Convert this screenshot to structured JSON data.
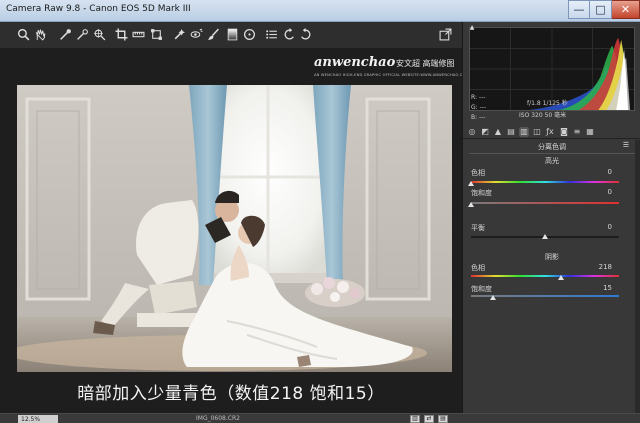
{
  "window": {
    "title": "Camera Raw 9.8 - Canon EOS 5D Mark III",
    "minimize_glyph": "—",
    "maximize_glyph": "□",
    "close_glyph": "✕"
  },
  "toolbar": {
    "tools": [
      "zoom-icon",
      "hand-icon",
      "white-balance-icon",
      "color-sampler-icon",
      "targeted-adjustment-icon",
      "crop-icon",
      "straighten-icon",
      "transform-icon",
      "spot-removal-icon",
      "red-eye-icon",
      "adjustment-brush-icon",
      "graduated-filter-icon",
      "radial-filter-icon",
      "preferences-icon",
      "rotate-left-icon",
      "rotate-right-icon"
    ],
    "fullscreen_icon": "fullscreen-icon"
  },
  "watermark": {
    "script": "anwenchao",
    "cn": "安文超 高端修图",
    "sub": "AN WENCHAO HIGH-END GRAPHIC OFFICIAL WEBSITE:WWW.ANWENCHAO.COM"
  },
  "caption": "暗部加入少量青色（数值218 饱和15）",
  "status": {
    "zoom": "12.5%",
    "filename": "IMG_0608.CR2"
  },
  "readout": {
    "r": "R:  ---",
    "g": "G:  ---",
    "b": "B:  ---",
    "aperture_shutter": "f/1.8   1/125 秒",
    "iso_focal": "ISO 320   50 毫米"
  },
  "panel": {
    "section_title": "分离色调",
    "highlights_title": "高光",
    "shadows_title": "阴影",
    "highlights": {
      "hue_label": "色相",
      "hue_value": "0",
      "sat_label": "饱和度",
      "sat_value": "0"
    },
    "balance": {
      "label": "平衡",
      "value": "0"
    },
    "shadows": {
      "hue_label": "色相",
      "hue_value": "218",
      "sat_label": "饱和度",
      "sat_value": "15"
    },
    "slider_levels": {
      "highlight_hue": 0,
      "highlight_sat": 0,
      "balance": 0.5,
      "shadow_hue": 0.606,
      "shadow_sat": 0.15
    }
  },
  "colors": {
    "background": "#2b2b2b",
    "panel": "#383838"
  }
}
